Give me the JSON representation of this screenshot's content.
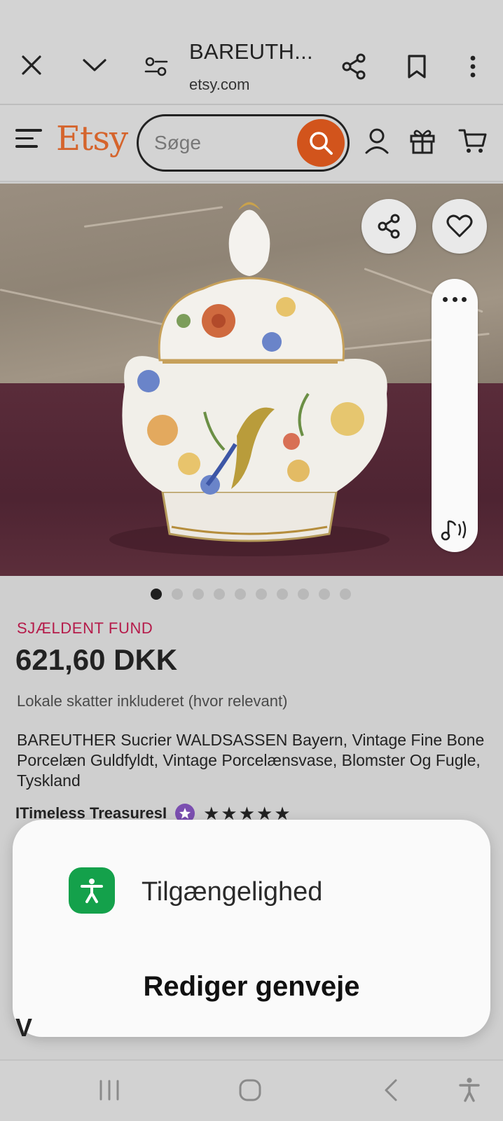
{
  "browser": {
    "page_title": "BAREUTH...",
    "url": "etsy.com"
  },
  "header": {
    "logo": "Etsy",
    "search_placeholder": "Søge",
    "accent_color": "#d2541c"
  },
  "gallery": {
    "image_count": 10,
    "active_index": 0
  },
  "product": {
    "badge": "SJÆLDENT FUND",
    "price": "621,60 DKK",
    "tax_note": "Lokale skatter inkluderet (hvor relevant)",
    "title": "BAREUTHER Sucrier WALDSASSEN Bayern, Vintage Fine Bone Porcelæn Guldfyldt, Vintage Porcelænsvase, Blomster Og Fugle, Tyskland",
    "shop_name": "ITimeless TreasuresI",
    "stars": "★★★★★",
    "rating_stars": 5
  },
  "accessibility_popup": {
    "item_label": "Tilgængelighed",
    "edit_label": "Rediger genveje",
    "peek_text": "V"
  }
}
